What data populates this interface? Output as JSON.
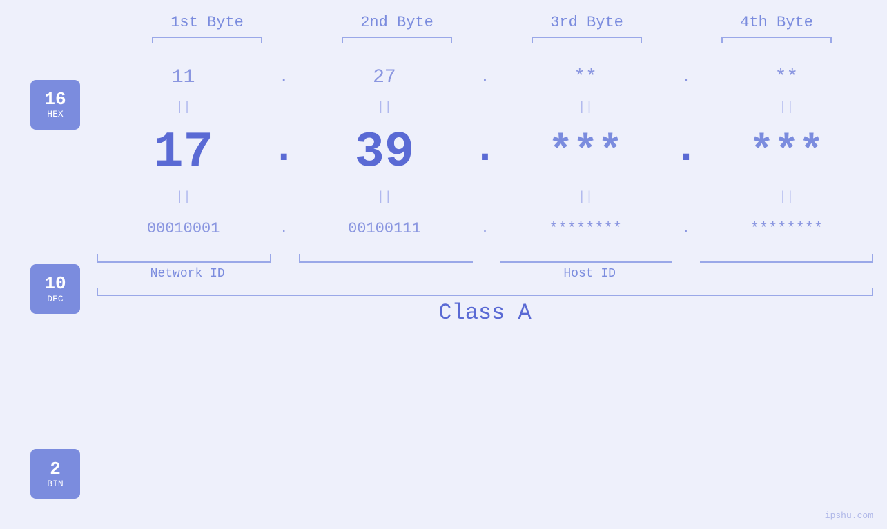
{
  "page": {
    "background": "#eef0fb",
    "accent_color": "#7b8cde",
    "dark_accent": "#5a6ad4",
    "watermark": "ipshu.com"
  },
  "byte_headers": {
    "b1": "1st Byte",
    "b2": "2nd Byte",
    "b3": "3rd Byte",
    "b4": "4th Byte"
  },
  "badges": {
    "hex": {
      "number": "16",
      "label": "HEX"
    },
    "dec": {
      "number": "10",
      "label": "DEC"
    },
    "bin": {
      "number": "2",
      "label": "BIN"
    }
  },
  "hex_row": {
    "b1": "11",
    "b2": "27",
    "b3": "**",
    "b4": "**",
    "dots": [
      ".",
      ".",
      "."
    ]
  },
  "dec_row": {
    "b1": "17",
    "b2": "39",
    "b3": "***",
    "b4": "***",
    "dots": [
      ".",
      ".",
      "."
    ]
  },
  "bin_row": {
    "b1": "00010001",
    "b2": "00100111",
    "b3": "********",
    "b4": "********",
    "dots": [
      ".",
      ".",
      "."
    ]
  },
  "equals": "||",
  "labels": {
    "network_id": "Network ID",
    "host_id": "Host ID",
    "class": "Class A"
  }
}
